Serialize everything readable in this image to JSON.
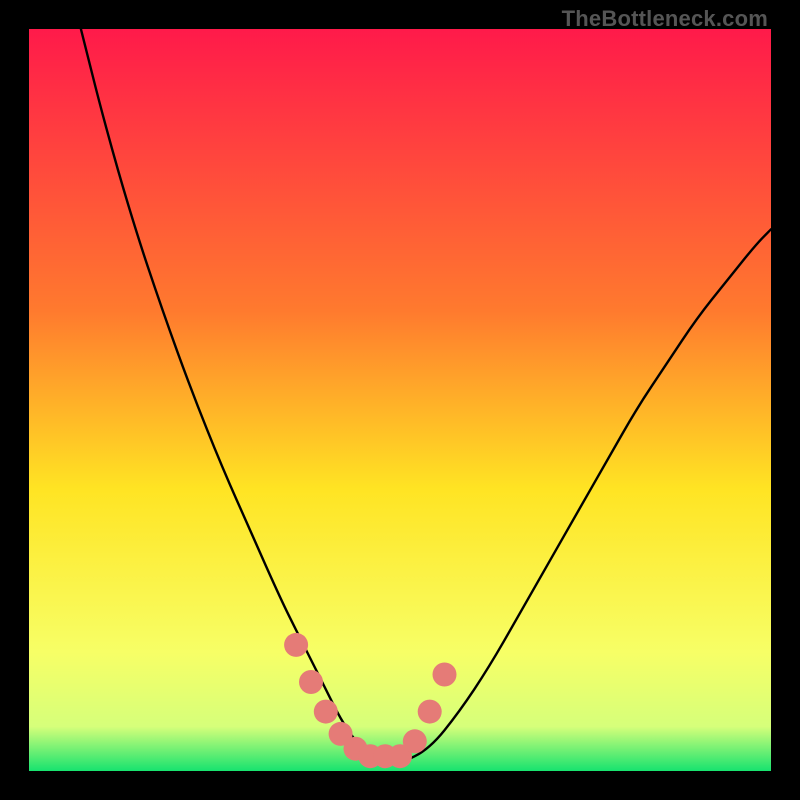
{
  "watermark": "TheBottleneck.com",
  "colors": {
    "background": "#000000",
    "gradient_top": "#ff1a4a",
    "gradient_mid1": "#ff7a2e",
    "gradient_mid2": "#ffe423",
    "gradient_low": "#f7ff66",
    "gradient_band": "#d6ff7a",
    "gradient_bottom": "#17e36f",
    "curve": "#000000",
    "markers": "#e57b77"
  },
  "chart_data": {
    "type": "line",
    "title": "",
    "xlabel": "",
    "ylabel": "",
    "xlim": [
      0,
      100
    ],
    "ylim": [
      0,
      100
    ],
    "grid": false,
    "legend": false,
    "series": [
      {
        "name": "bottleneck-curve",
        "x": [
          7,
          10,
          14,
          18,
          22,
          26,
          30,
          34,
          36,
          38,
          40,
          42,
          44,
          46,
          48,
          50,
          54,
          58,
          62,
          66,
          70,
          74,
          78,
          82,
          86,
          90,
          94,
          98,
          100
        ],
        "y": [
          100,
          88,
          74,
          62,
          51,
          41,
          32,
          23,
          19,
          15,
          11,
          7,
          4,
          2,
          1,
          1,
          3,
          8,
          14,
          21,
          28,
          35,
          42,
          49,
          55,
          61,
          66,
          71,
          73
        ]
      }
    ],
    "markers": {
      "name": "highlight-dots",
      "x": [
        36,
        38,
        40,
        42,
        44,
        46,
        48,
        50,
        52,
        54,
        56
      ],
      "y": [
        17,
        12,
        8,
        5,
        3,
        2,
        2,
        2,
        4,
        8,
        13
      ]
    },
    "annotations": [
      {
        "text": "TheBottleneck.com",
        "role": "watermark",
        "position": "top-right"
      }
    ]
  }
}
